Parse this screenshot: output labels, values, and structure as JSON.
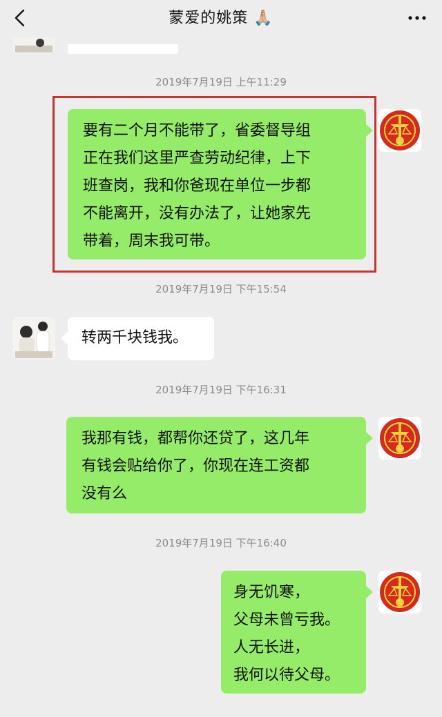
{
  "header": {
    "title": "蒙爱的姚策 🙏🏼"
  },
  "timestamps": [
    "2019年7月19日 上午11:29",
    "2019年7月19日 下午15:54",
    "2019年7月19日 下午16:31",
    "2019年7月19日 下午16:40"
  ],
  "messages": [
    {
      "sender": "self",
      "text": "要有二个月不能带了，省委督导组\n正在我们这里严查劳动纪律，上下\n班查岗，我和你爸现在单位一步都\n不能离开，没有办法了，让她家先\n带着，周末我可带。"
    },
    {
      "sender": "other",
      "text": "转两千块钱我。"
    },
    {
      "sender": "self",
      "text": "我那有钱，都帮你还贷了，这几年\n有钱会贴给你了，你现在连工资都\n没有么"
    },
    {
      "sender": "self",
      "text": "身无饥寒，\n父母未曾亏我。\n人无长进，\n我何以待父母。"
    }
  ],
  "colors": {
    "self_bubble": "#95ec69",
    "other_bubble": "#ffffff",
    "highlight_border": "#c8332e",
    "background": "#ededed"
  },
  "icons": {
    "back": "chevron-left-icon",
    "more": "more-dots-icon"
  }
}
